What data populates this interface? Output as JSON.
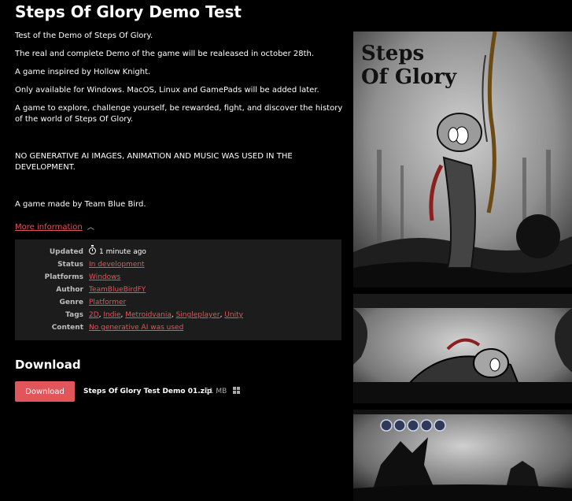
{
  "page": {
    "title": "Steps Of Glory Demo Test"
  },
  "description": [
    "Test of the Demo of Steps Of Glory.",
    "The real and complete Demo of the game will be realeased in october 28th.",
    "A game inspired by Hollow Knight.",
    "Only available for Windows. MacOS, Linux and GamePads will be added later.",
    "A game to explore, challenge yourself, be rewarded, fight, and discover the history of the world of Steps Of Glory.",
    "NO GENERATIVE AI IMAGES, ANIMATION AND MUSIC WAS USED IN THE DEVELOPMENT.",
    "A game made by Team Blue Bird."
  ],
  "more_info": {
    "label": "More information"
  },
  "info": {
    "updated": {
      "key": "Updated",
      "value": "1 minute ago"
    },
    "status": {
      "key": "Status",
      "value": "In development"
    },
    "platforms": {
      "key": "Platforms",
      "value": "Windows"
    },
    "author": {
      "key": "Author",
      "value": "TeamBlueBirdFY"
    },
    "genre": {
      "key": "Genre",
      "value": "Platformer"
    },
    "tags": {
      "key": "Tags",
      "values": [
        "2D",
        "Indie",
        "Metroidvania",
        "Singleplayer",
        "Unity"
      ],
      "sep": ", "
    },
    "content": {
      "key": "Content",
      "value": "No generative AI was used"
    }
  },
  "download": {
    "heading": "Download",
    "button_label": "Download",
    "file_name": "Steps Of Glory Test Demo 01.zip",
    "file_size": "51 MB",
    "platform_icon": "windows-icon"
  },
  "cover": {
    "logo_line1": "Steps",
    "logo_line2": "Of Glory"
  },
  "colors": {
    "accent": "#e0565b",
    "background": "#000000",
    "panel": "#1c1c1c"
  }
}
